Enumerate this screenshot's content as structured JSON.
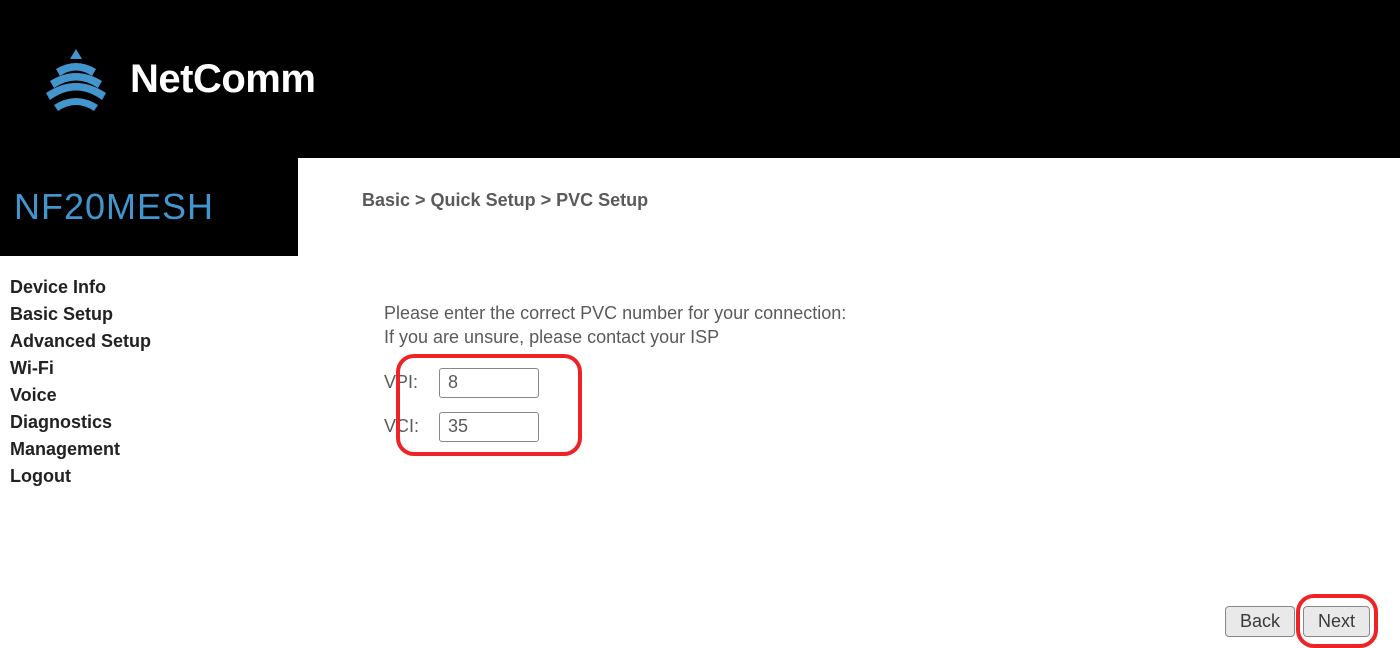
{
  "header": {
    "brand": "NetComm"
  },
  "sidebar": {
    "model": "NF20MESH",
    "items": [
      {
        "label": "Device Info"
      },
      {
        "label": "Basic Setup"
      },
      {
        "label": "Advanced Setup"
      },
      {
        "label": "Wi-Fi"
      },
      {
        "label": "Voice"
      },
      {
        "label": "Diagnostics"
      },
      {
        "label": "Management"
      },
      {
        "label": "Logout"
      }
    ]
  },
  "main": {
    "breadcrumb": "Basic > Quick Setup > PVC Setup",
    "instruction_line1": "Please enter the correct PVC number for your connection:",
    "instruction_line2": "If you are unsure, please contact your ISP",
    "vpi_label": "VPI:",
    "vpi_value": "8",
    "vci_label": "VCI:",
    "vci_value": "35",
    "back_label": "Back",
    "next_label": "Next"
  }
}
